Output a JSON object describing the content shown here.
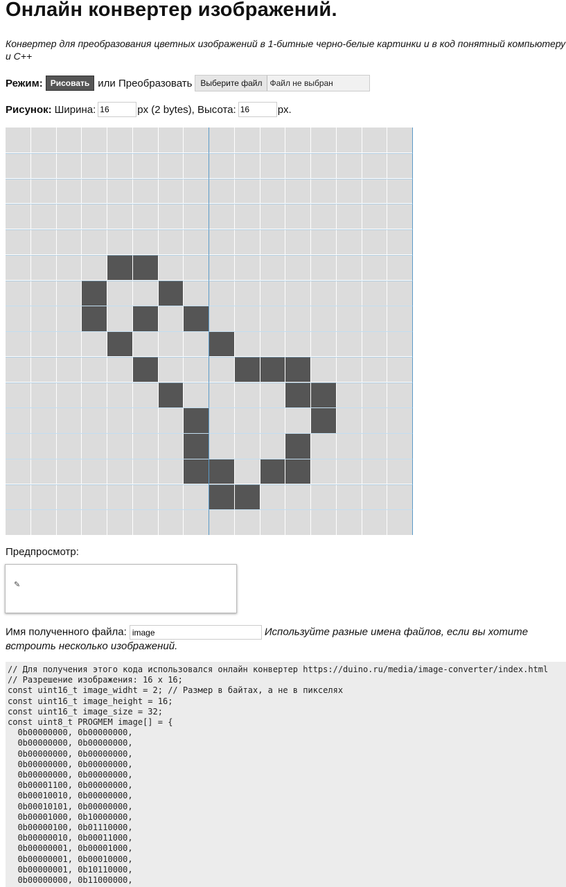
{
  "title": "Онлайн конвертер изображений.",
  "description": "Конвертер для преобразования цветных изображений в 1-битные черно-белые картинки и в код понятный компьютеру и C++",
  "mode": {
    "label": "Режим:",
    "draw_button": "Рисовать",
    "or_text": "или Преобразовать",
    "file_button": "Выберите файл",
    "file_status": "Файл не выбран"
  },
  "size": {
    "label": "Рисунок:",
    "width_label": "Ширина:",
    "width_value": "16",
    "width_unit": "px (2 bytes), Высота:",
    "height_value": "16",
    "height_unit": "px."
  },
  "pixel_grid": {
    "columns": 16,
    "rows": 16,
    "on_color": "#555555",
    "off_color": "#dcdcdc",
    "pixels": [
      "0000000000000000",
      "0000000000000000",
      "0000000000000000",
      "0000000000000000",
      "0000000000000000",
      "0000110000000000",
      "0001001000000000",
      "0001010100000000",
      "0000100010000000",
      "0000010001110000",
      "0000001000011000",
      "0000000100001000",
      "0000000100010000",
      "0000000110110000",
      "0000000011000000",
      "0000000000000000"
    ]
  },
  "preview": {
    "label": "Предпросмотр:",
    "icon": "brush-icon"
  },
  "output_file": {
    "label": "Имя полученного файла:",
    "value": "image",
    "hint": "Используйте разные имена файлов, если вы хотите встроить несколько изображений."
  },
  "code_lines": [
    "// Для получения этого кода использовался онлайн конвертер https://duino.ru/media/image-converter/index.html",
    "// Разрешение изображения: 16 x 16;",
    "const uint16_t image_widht = 2; // Размер в байтах, а не в пикселях",
    "const uint16_t image_height = 16;",
    "const uint16_t image_size = 32;",
    "const uint8_t PROGMEM image[] = {",
    "  0b00000000, 0b00000000,",
    "  0b00000000, 0b00000000,",
    "  0b00000000, 0b00000000,",
    "  0b00000000, 0b00000000,",
    "  0b00000000, 0b00000000,",
    "  0b00001100, 0b00000000,",
    "  0b00010010, 0b00000000,",
    "  0b00010101, 0b00000000,",
    "  0b00001000, 0b10000000,",
    "  0b00000100, 0b01110000,",
    "  0b00000010, 0b00011000,",
    "  0b00000001, 0b00001000,",
    "  0b00000001, 0b00010000,",
    "  0b00000001, 0b10110000,",
    "  0b00000000, 0b11000000,"
  ]
}
